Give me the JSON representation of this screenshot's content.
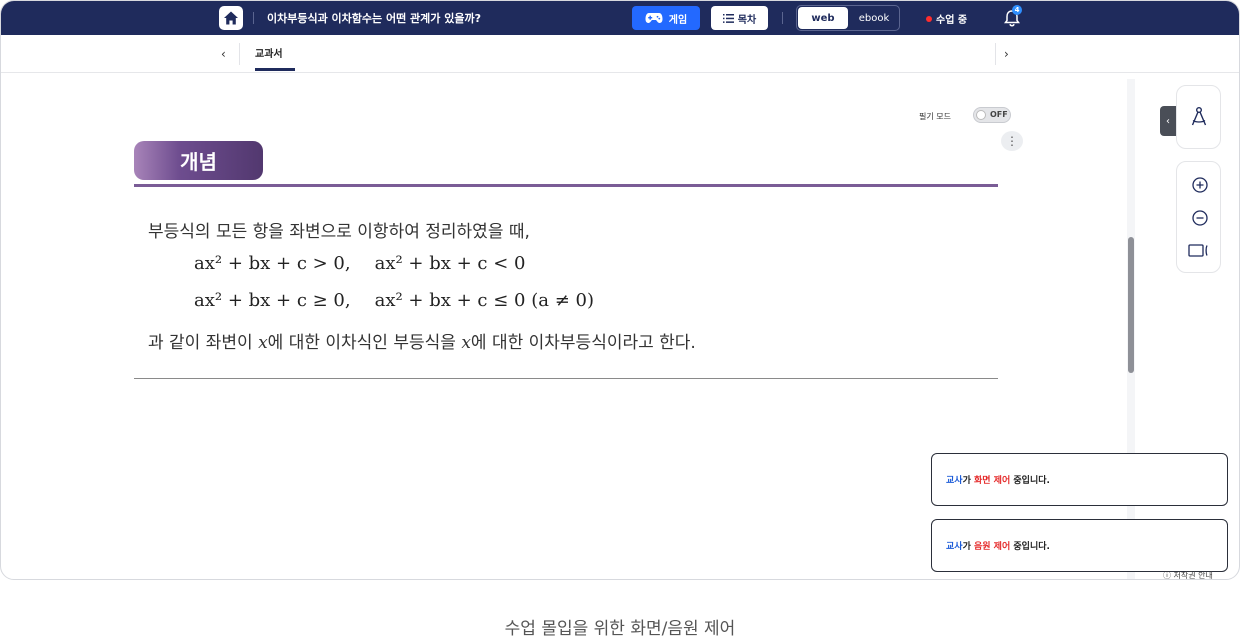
{
  "topbar": {
    "lesson_title": "이차부등식과 이차함수는 어떤 관계가 있을까?",
    "game_label": "게임",
    "toc_label": "목차",
    "view_web": "web",
    "view_ebook": "ebook",
    "class_status": "수업 중",
    "notification_count": "4",
    "bg_color": "#1f2b5c",
    "accent_color": "#2369ff"
  },
  "tabs": {
    "active_label": "교과서",
    "prev_icon": "chevron-left-icon",
    "next_icon": "chevron-right-icon"
  },
  "content": {
    "write_mode_label": "필기 모드",
    "write_mode_state": "OFF",
    "concept_badge": "개념",
    "line1": "부등식의 모든 항을 좌변으로 이항하여 정리하였을 때,",
    "math_row1_a": "ax² + bx + c > 0,",
    "math_row1_b": "ax² + bx + c < 0",
    "math_row2_a": "ax² + bx + c ≥ 0,",
    "math_row2_b": "ax² + bx + c ≤ 0 (a ≠ 0)",
    "line2_part1": "과 같이 좌변이 ",
    "line2_var1": "x",
    "line2_part2": "에 대한 이차식인 부등식을 ",
    "line2_var2": "x",
    "line2_part3": "에 대한 이차부등식이라고 한다."
  },
  "tools": {
    "compass_icon": "compass-icon",
    "zoom_in_icon": "zoom-in-icon",
    "zoom_out_icon": "zoom-out-icon",
    "screen_icon": "screen-icon"
  },
  "toasts": [
    {
      "who": "교사",
      "mid": "가 ",
      "what": "화면 제어",
      "rest": " 중입니다."
    },
    {
      "who": "교사",
      "mid": "가 ",
      "what": "음원 제어",
      "rest": " 중입니다."
    }
  ],
  "copyright": "ⓘ 저작권 안내",
  "caption": "수업 몰입을 위한 화면/음원 제어"
}
